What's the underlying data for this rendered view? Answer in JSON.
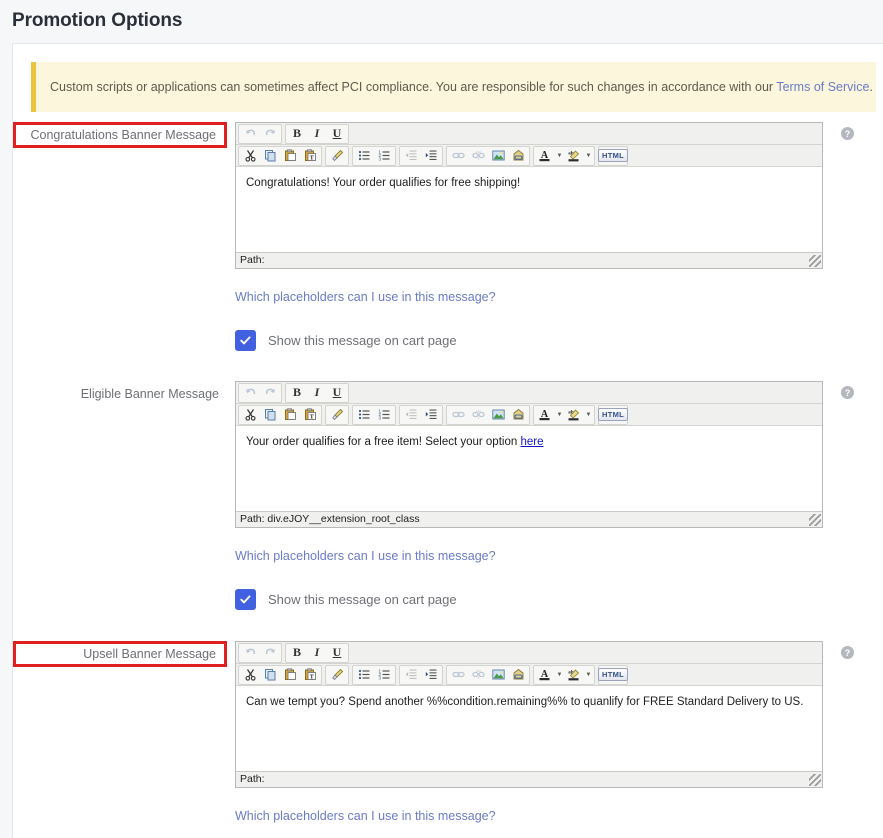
{
  "page": {
    "title": "Promotion Options"
  },
  "callout": {
    "text": "Custom scripts or applications can sometimes affect PCI compliance. You are responsible for such changes in accordance with our ",
    "link_label": "Terms of Service",
    "suffix": ".",
    "accent_color": "#ebc53f",
    "background_color": "#fcf6dd"
  },
  "toolbar": {
    "undo": "undo-icon",
    "redo": "redo-icon",
    "bold": "B",
    "italic": "I",
    "underline": "U",
    "cut": "cut-icon",
    "copy": "copy-icon",
    "paste": "paste-icon",
    "paste_text": "paste-text-icon",
    "clean": "clean-format-icon",
    "bullist": "bullet-list-icon",
    "numlist": "numbered-list-icon",
    "outdent": "outdent-icon",
    "indent": "indent-icon",
    "link": "link-icon",
    "unlink": "unlink-icon",
    "image": "image-icon",
    "anchor": "anchor-icon",
    "forecolor": "A",
    "backcolor": "abc-highlight-icon",
    "html": "HTML",
    "dropdown_arrow": "▼"
  },
  "fields": [
    {
      "label": "Congratulations Banner Message",
      "highlighted": true,
      "content_html": "Congratulations! Your order qualifies for free shipping!",
      "path": "Path:",
      "placeholder_link": "Which placeholders can I use in this message?",
      "checkbox": {
        "label": "Show this message on cart page",
        "checked": true
      },
      "help": "?"
    },
    {
      "label": "Eligible Banner Message",
      "highlighted": false,
      "content_html": "Your order qualifies for a free item! Select your option ",
      "content_link": "here",
      "path": "Path: div.eJOY__extension_root_class",
      "placeholder_link": "Which placeholders can I use in this message?",
      "checkbox": {
        "label": "Show this message on cart page",
        "checked": true
      },
      "help": "?"
    },
    {
      "label": "Upsell Banner Message",
      "highlighted": true,
      "content_html": "Can we tempt you? Spend another %%condition.remaining%% to quanlify for FREE Standard Delivery to US.",
      "path": "Path:",
      "placeholder_link": "Which placeholders can I use in this message?",
      "help": "?"
    }
  ],
  "colors": {
    "highlight_border": "#e02020",
    "link": "#6a7bc8",
    "checkbox_fill": "#4161e0",
    "panel_bg": "#ffffff",
    "page_bg": "#f6f7f9"
  }
}
